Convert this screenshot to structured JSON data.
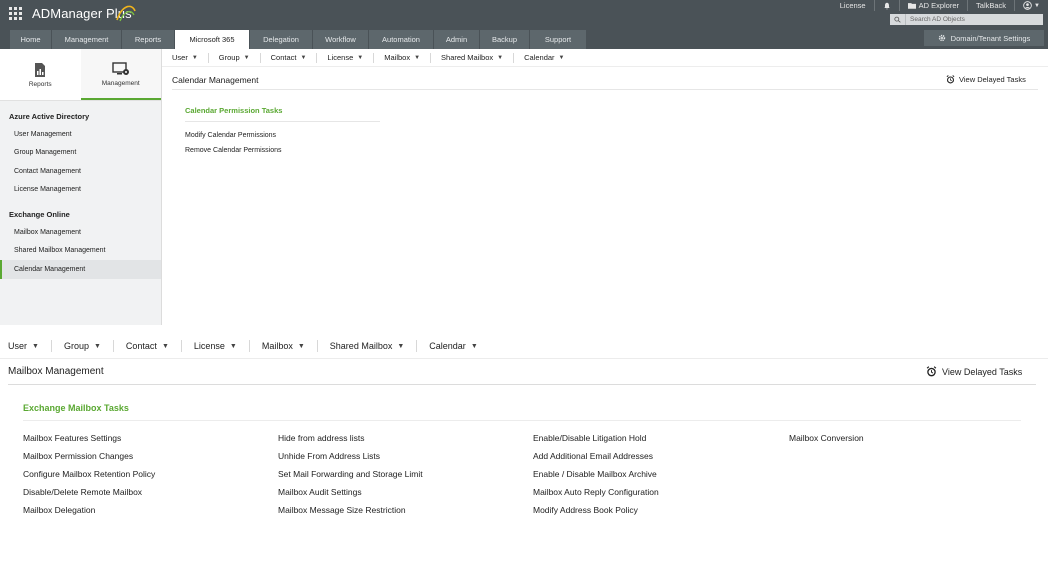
{
  "brand": {
    "name": "ADManager Plus"
  },
  "top_links": {
    "license": "License",
    "ad_explorer": "AD Explorer",
    "talkback": "TalkBack"
  },
  "search": {
    "placeholder": "Search AD Objects"
  },
  "tabs": [
    {
      "label": "Home"
    },
    {
      "label": "Management"
    },
    {
      "label": "Reports"
    },
    {
      "label": "Microsoft 365"
    },
    {
      "label": "Delegation"
    },
    {
      "label": "Workflow"
    },
    {
      "label": "Automation"
    },
    {
      "label": "Admin"
    },
    {
      "label": "Backup"
    },
    {
      "label": "Support"
    }
  ],
  "active_tab": "Microsoft 365",
  "settings_button": "Domain/Tenant Settings",
  "sidebar": {
    "reports_label": "Reports",
    "management_label": "Management",
    "group1": "Azure Active Directory",
    "group1_items": [
      "User Management",
      "Group Management",
      "Contact Management",
      "License Management"
    ],
    "group2": "Exchange Online",
    "group2_items": [
      "Mailbox Management",
      "Shared Mailbox Management",
      "Calendar Management"
    ],
    "selected_item": "Calendar Management"
  },
  "subnav": [
    "User",
    "Group",
    "Contact",
    "License",
    "Mailbox",
    "Shared Mailbox",
    "Calendar"
  ],
  "upper": {
    "title": "Calendar Management",
    "delayed_tasks": "View Delayed Tasks",
    "section": "Calendar Permission Tasks",
    "tasks": [
      "Modify Calendar Permissions",
      "Remove Calendar Permissions"
    ]
  },
  "lower": {
    "title": "Mailbox Management",
    "delayed_tasks": "View Delayed Tasks",
    "section": "Exchange Mailbox Tasks",
    "columns": [
      [
        "Mailbox Features Settings",
        "Mailbox Permission Changes",
        "Configure Mailbox Retention Policy",
        "Disable/Delete Remote Mailbox",
        "Mailbox Delegation"
      ],
      [
        "Hide from address lists",
        "Unhide From Address Lists",
        "Set Mail Forwarding and Storage Limit",
        "Mailbox Audit Settings",
        "Mailbox Message Size Restriction"
      ],
      [
        "Enable/Disable Litigation Hold",
        "Add Additional Email Addresses",
        "Enable / Disable Mailbox Archive",
        "Mailbox Auto Reply Configuration",
        "Modify Address Book Policy"
      ],
      [
        "Mailbox Conversion"
      ]
    ]
  },
  "colors": {
    "accent_green": "#5aa832",
    "topbar": "#4a5257",
    "tab_bg": "#5d676c"
  }
}
